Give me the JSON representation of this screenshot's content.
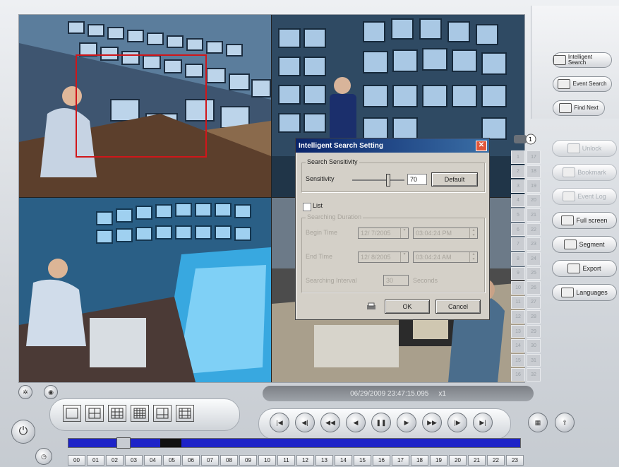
{
  "dialog": {
    "title": "Intelligent Search Setting",
    "close_icon": "close-icon",
    "group_sensitivity": "Search Sensitivity",
    "sensitivity_label": "Sensitivity",
    "sensitivity_value": "70",
    "default_button": "Default",
    "list_label": "List",
    "list_checked": false,
    "group_duration": "Searching Duration",
    "begin_label": "Begin Time",
    "begin_date": "12/ 7/2005",
    "begin_time": "03:04:24 PM",
    "end_label": "End Time",
    "end_date": "12/ 8/2005",
    "end_time": "03:04:24 AM",
    "interval_label": "Searching Interval",
    "interval_value": "30",
    "interval_unit": "Seconds",
    "ok_button": "OK",
    "cancel_button": "Cancel"
  },
  "right_panel": {
    "intelligent_search": "Intelligent Search",
    "event_search": "Event Search",
    "find_next": "Find Next",
    "unlock": "Unlock",
    "bookmark": "Bookmark",
    "event_log": "Event Log",
    "full_screen": "Full screen",
    "segment": "Segment",
    "export": "Export",
    "languages": "Languages"
  },
  "channels": [
    "1",
    "17",
    "2",
    "18",
    "3",
    "19",
    "4",
    "20",
    "5",
    "21",
    "6",
    "22",
    "7",
    "23",
    "8",
    "24",
    "9",
    "25",
    "10",
    "26",
    "11",
    "27",
    "12",
    "28",
    "13",
    "29",
    "14",
    "30",
    "15",
    "31",
    "16",
    "32"
  ],
  "status": {
    "datetime": "06/29/2009 23:47:15.095",
    "speed": "x1"
  },
  "hours": [
    "00",
    "01",
    "02",
    "03",
    "04",
    "05",
    "06",
    "07",
    "08",
    "09",
    "10",
    "11",
    "12",
    "13",
    "14",
    "15",
    "16",
    "17",
    "18",
    "19",
    "20",
    "21",
    "22",
    "23"
  ],
  "colors": {
    "motion_box": "#d0161a",
    "timeline": "#1d23c8",
    "title_bar": "#0a246a"
  },
  "playback_buttons": [
    "first-frame-icon",
    "prev-frame-icon",
    "rewind-icon",
    "play-backward-icon",
    "pause-icon",
    "play-icon",
    "fast-forward-icon",
    "next-frame-icon",
    "last-frame-icon"
  ]
}
